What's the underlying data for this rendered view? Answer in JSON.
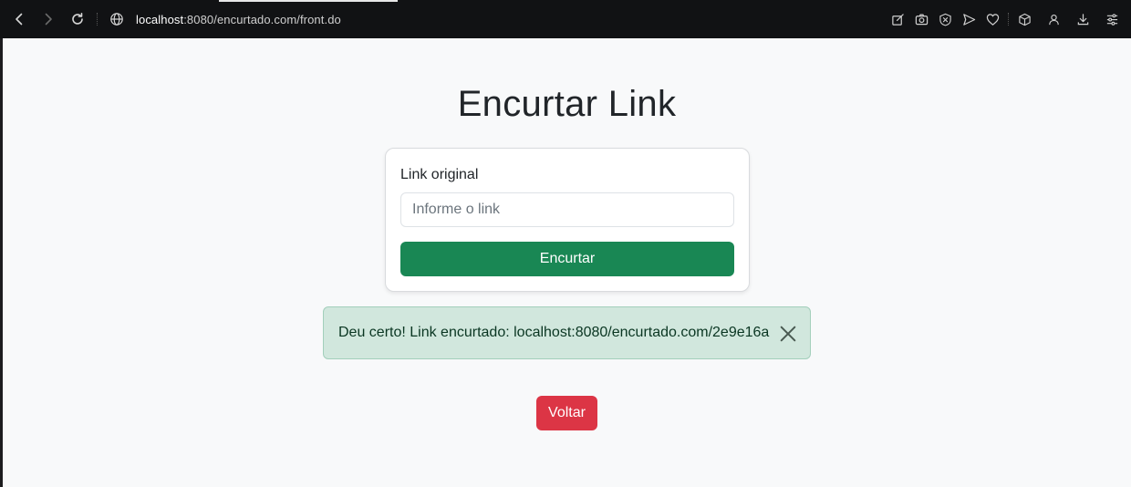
{
  "browser": {
    "url_host": "localhost",
    "url_rest": ":8080/encurtado.com/front.do",
    "icons": {
      "back": "back-arrow-icon",
      "forward": "forward-arrow-icon",
      "reload": "reload-icon",
      "site_info": "globe-icon",
      "toolbar": [
        "edit-icon",
        "camera-icon",
        "shield-x-icon",
        "send-icon",
        "heart-icon",
        "cube-icon",
        "profile-icon",
        "download-icon",
        "settings-sliders-icon"
      ]
    }
  },
  "page": {
    "title": "Encurtar Link",
    "form": {
      "label": "Link original",
      "input_placeholder": "Informe o link",
      "input_value": "",
      "submit_label": "Encurtar"
    },
    "alert": {
      "message": "Deu certo! Link encurtado: localhost:8080/encurtado.com/2e9e16a",
      "close_icon": "close-icon"
    },
    "back_button_label": "Voltar"
  },
  "colors": {
    "success": "#198754",
    "danger": "#dc3545",
    "alert_bg": "#d1e7dd",
    "page_bg": "#f8f9fa"
  }
}
